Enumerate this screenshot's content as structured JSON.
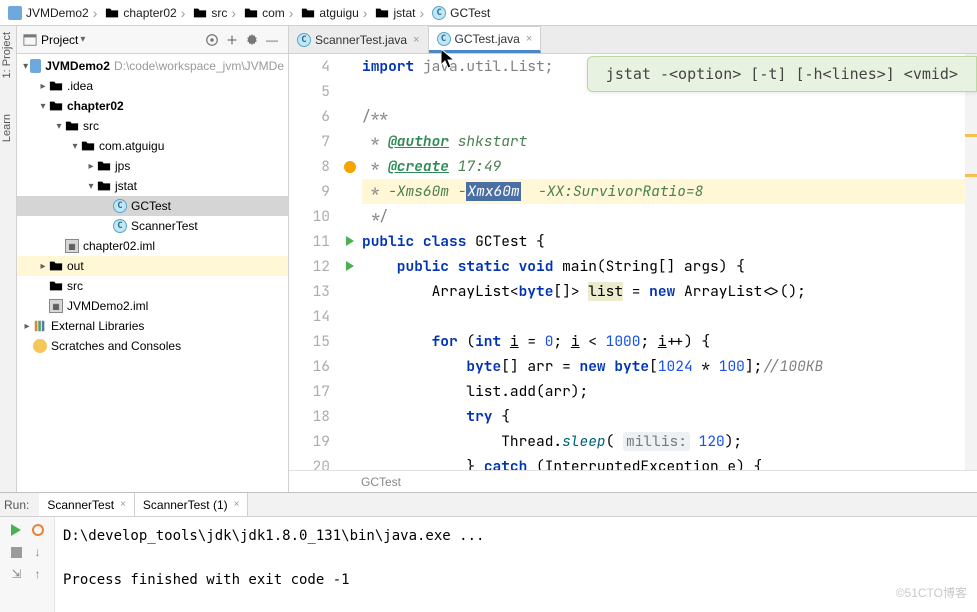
{
  "breadcrumbs": [
    "JVMDemo2",
    "chapter02",
    "src",
    "com",
    "atguigu",
    "jstat",
    "GCTest"
  ],
  "breadcrumb_types": [
    "module",
    "folder-blue",
    "folder-teal",
    "folder-gray",
    "folder-gray",
    "folder-gray",
    "class"
  ],
  "project_panel": {
    "title": "Project",
    "tree": {
      "root": {
        "label": "JVMDemo2",
        "path": "D:\\code\\workspace_jvm\\JVMDe"
      },
      "idea": ".idea",
      "chapter02": "chapter02",
      "src": "src",
      "pkg": "com.atguigu",
      "jps": "jps",
      "jstat": "jstat",
      "gctest": "GCTest",
      "scannertest": "ScannerTest",
      "iml": "chapter02.iml",
      "out": "out",
      "src2": "src",
      "iml2": "JVMDemo2.iml",
      "ext": "External Libraries",
      "scratches": "Scratches and Consoles"
    }
  },
  "tabs": {
    "t0": {
      "label": "ScannerTest.java"
    },
    "t1": {
      "label": "GCTest.java"
    }
  },
  "hint_balloon": "jstat -<option> [-t] [-h<lines>] <vmid>",
  "editor_breadcrumb": "GCTest",
  "gutter_lines": [
    "4",
    "5",
    "6",
    "7",
    "8",
    "9",
    "10",
    "11",
    "12",
    "13",
    "14",
    "15",
    "16",
    "17",
    "18",
    "19",
    "20"
  ],
  "code": {
    "l4a": "import ",
    "l4b": "java.util.List;",
    "l6": "/**",
    "l7a": " * ",
    "l7b": "@author",
    "l7c": " shkstart",
    "l8a": " * ",
    "l8b": "@create",
    "l8c": " 17:49",
    "l9a": " * ",
    "l9b": "-Xms60m -",
    "l9c": "Xmx60m",
    "l9d": "  -XX:SurvivorRatio=8",
    "l10": " */",
    "l11a": "public class ",
    "l11b": "GCTest {",
    "l12a": "    public static void ",
    "l12b": "main",
    "l12c": "(String[] args) {",
    "l13a": "        ArrayList<",
    "l13b": "byte",
    "l13c": "[]> ",
    "l13d": "list",
    "l13e": " = ",
    "l13f": "new ",
    "l13g": "ArrayList<>();",
    "l15a": "        for ",
    "l15b": "(",
    "l15c": "int ",
    "l15d": "i",
    "l15e": " = ",
    "l15f": "0",
    "l15g": "; ",
    "l15h": "i",
    "l15i": " < ",
    "l15j": "1000",
    "l15k": "; ",
    "l15l": "i",
    "l15m": "++) {",
    "l16a": "            ",
    "l16b": "byte",
    "l16c": "[] arr = ",
    "l16d": "new byte",
    "l16e": "[",
    "l16f": "1024",
    "l16g": " * ",
    "l16h": "100",
    "l16i": "];",
    "l16j": "//100KB",
    "l17": "            list.add(arr);",
    "l18a": "            ",
    "l18b": "try ",
    "l18c": "{",
    "l19a": "                Thread.",
    "l19b": "sleep",
    "l19c": "( ",
    "l19d": "millis:",
    "l19e": " ",
    "l19f": "120",
    "l19g": ");",
    "l20a": "            } ",
    "l20b": "catch ",
    "l20c": "(InterruptedException e) {"
  },
  "run_panel": {
    "label": "Run:",
    "tab0": "ScannerTest",
    "tab1": "ScannerTest (1)",
    "console_line1": "D:\\develop_tools\\jdk\\jdk1.8.0_131\\bin\\java.exe ...",
    "console_line2": "Process finished with exit code -1"
  },
  "watermark": "©51CTO博客"
}
